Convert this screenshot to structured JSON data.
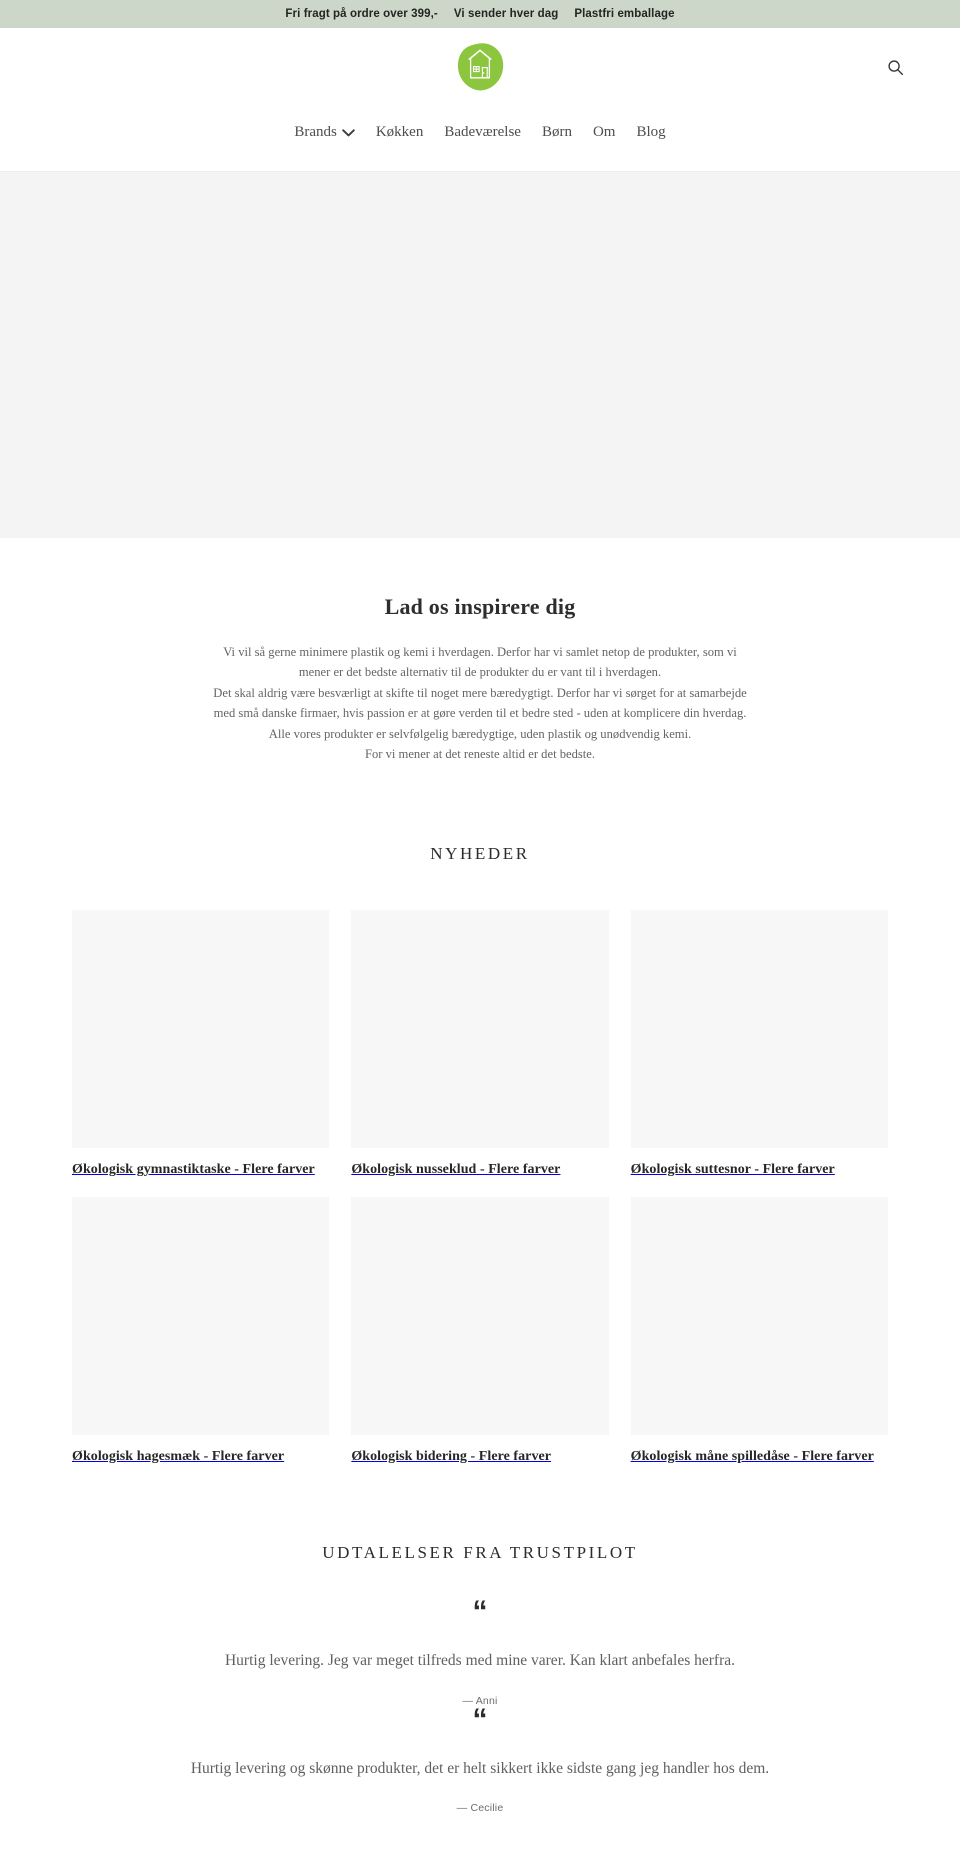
{
  "announcement": {
    "items": [
      "Fri fragt på ordre over 399,-",
      "Vi sender hver dag",
      "Plastfri emballage"
    ],
    "background_color": "#ccd6c9"
  },
  "header": {
    "logo": {
      "icon": "house-logo",
      "blob_color": "#8cc63f",
      "blob_color_light": "#a4d163"
    },
    "search": {
      "icon": "search-icon",
      "label": "Søg"
    },
    "nav": [
      {
        "label": "Brands",
        "has_dropdown": true,
        "icon": "chevron-down-icon"
      },
      {
        "label": "Køkken",
        "has_dropdown": false
      },
      {
        "label": "Badeværelse",
        "has_dropdown": false
      },
      {
        "label": "Børn",
        "has_dropdown": false
      },
      {
        "label": "Om",
        "has_dropdown": false
      },
      {
        "label": "Blog",
        "has_dropdown": false
      }
    ]
  },
  "hero": {
    "background_color": "#f4f4f4"
  },
  "inspire": {
    "title": "Lad os inspirere dig",
    "paragraph_lines": [
      "Vi vil så gerne minimere plastik og kemi i hverdagen. Derfor har vi samlet netop de produkter, som vi mener er det bedste alternativ til de produkter du er vant til i hverdagen.",
      "Det skal aldrig være besværligt at skifte til noget mere bæredygtigt. Derfor har vi sørget for at samarbejde med små danske firmaer, hvis passion er at gøre verden til et bedre sted - uden at komplicere din hverdag.",
      "Alle vores produkter er selvfølgelig bæredygtige, uden plastik og unødvendig kemi.",
      "For vi mener at det reneste altid er det bedste."
    ]
  },
  "news": {
    "title": "NYHEDER",
    "products": [
      {
        "title": "Økologisk gymnastiktaske - Flere farver"
      },
      {
        "title": "Økologisk nusseklud - Flere farver"
      },
      {
        "title": "Økologisk suttesnor - Flere farver"
      },
      {
        "title": "Økologisk hagesmæk - Flere farver"
      },
      {
        "title": "Økologisk bidering - Flere farver"
      },
      {
        "title": "Økologisk måne spilledåse - Flere farver"
      }
    ]
  },
  "testimonials": {
    "title": "UDTALELSER FRA TRUSTPILOT",
    "quote_glyph": "“",
    "items": [
      {
        "text": "Hurtig levering. Jeg var meget tilfreds med mine varer. Kan klart anbefales herfra.",
        "author": "— Anni"
      },
      {
        "text": "Hurtig levering og skønne produkter, det er helt sikkert ikke sidste gang jeg handler hos dem.",
        "author": "— Cecilie"
      }
    ]
  }
}
